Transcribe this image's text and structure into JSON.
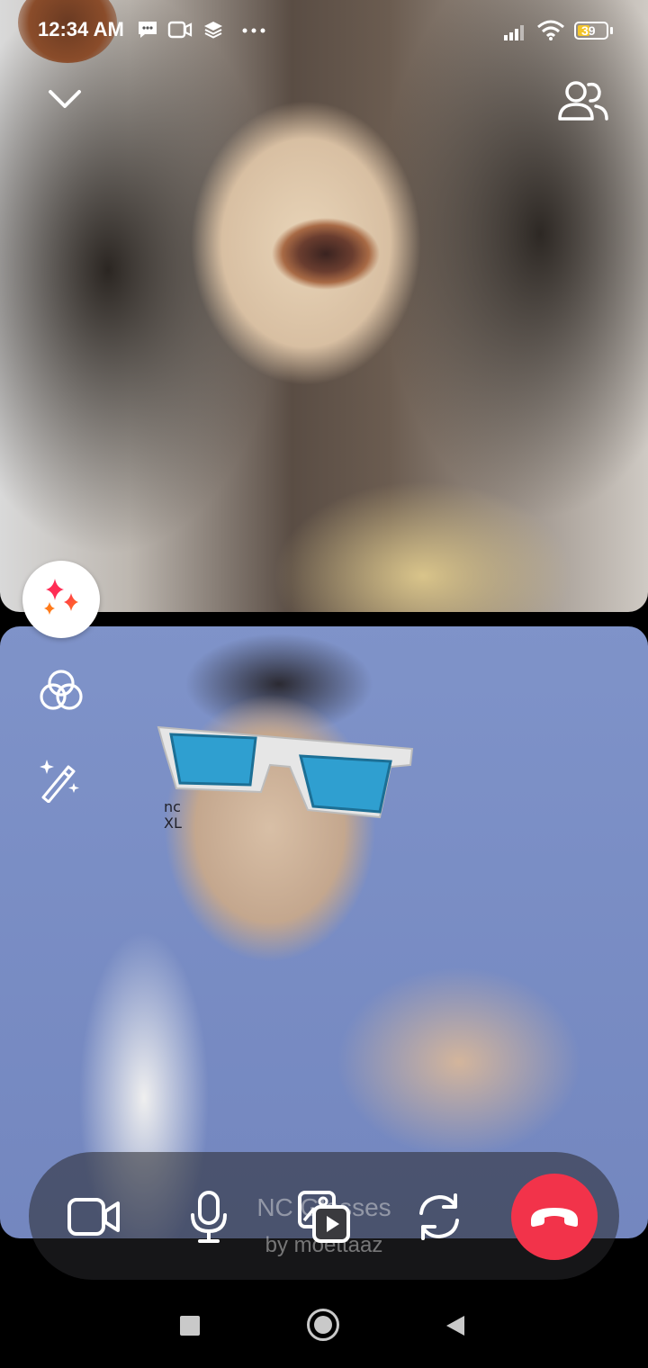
{
  "status_bar": {
    "time": "12:34 AM",
    "battery_level": "39",
    "icons": [
      "chat-notification-icon",
      "video-notification-icon",
      "layers-notification-icon",
      "more-dots-icon",
      "signal-icon",
      "wifi-icon",
      "battery-icon"
    ]
  },
  "call": {
    "collapse_icon": "chevron-down-icon",
    "participants_icon": "participants-icon",
    "effects_icon": "sparkles-icon",
    "filters_icon": "color-filter-icon",
    "magic_icon": "magic-wand-icon"
  },
  "active_effect": {
    "name": "NC Glasses",
    "credit": "by moettaaz"
  },
  "controls": {
    "items": [
      "camera-icon",
      "microphone-icon",
      "share-media-icon",
      "flip-camera-icon",
      "end-call-icon"
    ]
  },
  "colors": {
    "end_call": "#f2334a",
    "battery_fill": "#f3c52b",
    "effects_gradient_start": "#ff2d55",
    "effects_gradient_end": "#ff7a1a"
  }
}
